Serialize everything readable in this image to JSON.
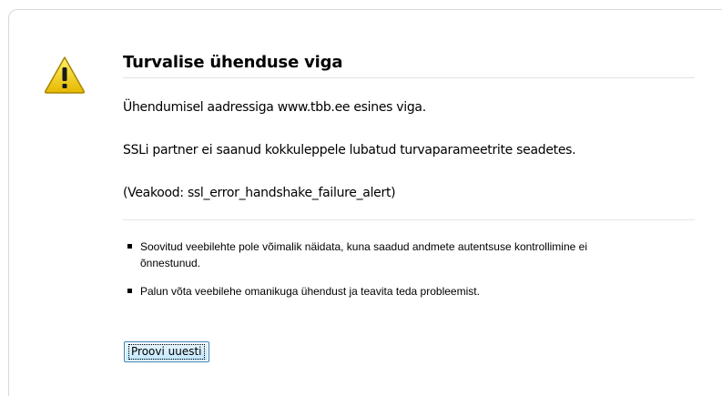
{
  "error": {
    "title": "Turvalise ühenduse viga",
    "message": "Ühendumisel aadressiga www.tbb.ee esines viga.",
    "detail": "SSLi partner ei saanud kokkuleppele lubatud turvaparameetrite seadetes.",
    "error_code": "(Veakood: ssl_error_handshake_failure_alert)",
    "icon": "warning-triangle-icon",
    "icon_color": "#f5d000"
  },
  "notes": [
    "Soovitud veebilehte pole võimalik näidata, kuna saadud andmete autentsuse kontrollimine ei õnnestunud.",
    "Palun võta veebilehe omanikuga ühendust ja teavita teda probleemist."
  ],
  "actions": {
    "retry_label": "Proovi uuesti"
  }
}
